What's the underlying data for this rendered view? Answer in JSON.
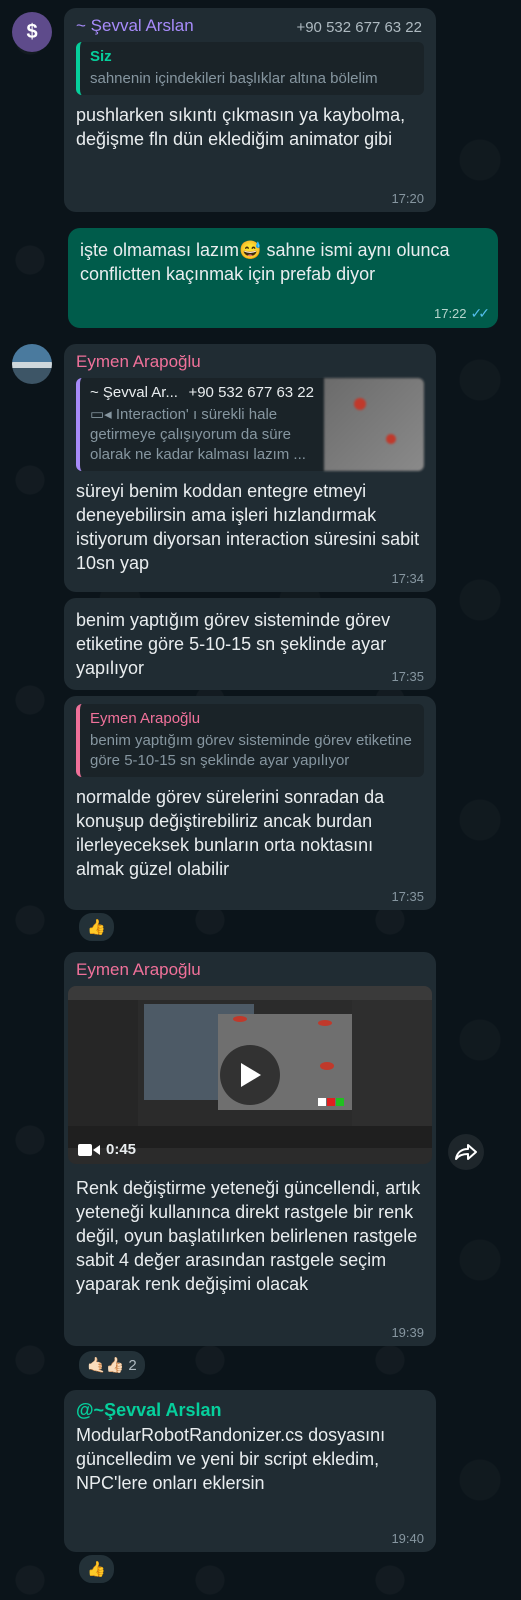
{
  "messages": [
    {
      "sender": "~ Şevval Arslan",
      "phone": "+90 532 677 63 22",
      "quote_author": "Siz",
      "quote_text": "sahnenin içindekileri başlıklar altına bölelim",
      "text": "pushlarken sıkıntı çıkmasın ya kaybolma, değişme fln dün eklediğim animator gibi",
      "time": "17:20"
    },
    {
      "text_before_emoji": "işte olmaması lazım",
      "emoji": "😅",
      "text_after_emoji": " sahne ismi aynı olunca conflictten kaçınmak için prefab diyor",
      "time": "17:22",
      "ticks": "✓✓"
    },
    {
      "sender": "Eymen Arapoğlu",
      "quote_author": "~ Şevval Ar...",
      "quote_phone": "+90 532 677 63 22",
      "quote_text": "Interaction' ı sürekli hale getirmeye çalışıyorum da süre olarak ne kadar kalması lazım ...",
      "text": "süreyi benim koddan entegre etmeyi deneyebilirsin ama işleri hızlandırmak istiyorum diyorsan interaction süresini sabit 10sn yap",
      "time": "17:34"
    },
    {
      "text": "benim yaptığım görev sisteminde görev etiketine göre 5-10-15 sn şeklinde ayar yapılıyor",
      "time": "17:35"
    },
    {
      "quote_author": "Eymen Arapoğlu",
      "quote_text": "benim yaptığım görev sisteminde görev etiketine göre 5-10-15 sn şeklinde ayar yapılıyor",
      "text": "normalde görev sürelerini sonradan da konuşup değiştirebiliriz ancak burdan ilerleyeceksek bunların orta noktasını almak güzel olabilir",
      "time": "17:35",
      "reaction": "👍"
    },
    {
      "sender": "Eymen Arapoğlu",
      "video_duration": "0:45",
      "text": "Renk değiştirme yeteneği güncellendi, artık yeteneği kullanınca direkt rastgele bir renk değil, oyun başlatılırken belirlenen rastgele sabit 4 değer arasından rastgele seçim yaparak renk değişimi olacak",
      "time": "19:39",
      "reactions": "🤙🏻👍🏻",
      "reaction_count": "2"
    },
    {
      "mention": "@~Şevval Arslan",
      "text": "ModularRobotRandonizer.cs dosyasını güncelledim ve yeni bir script ekledim, NPC'lere onları eklersin",
      "time": "19:40",
      "reaction": "👍"
    }
  ],
  "avatars": {
    "first": "$"
  },
  "colors": {
    "incoming_bubble": "#202c33",
    "outgoing_bubble": "#005c4b",
    "sender_sevval": "#a78bfa",
    "sender_eymen": "#f0719a",
    "mention": "#06cf9c"
  }
}
